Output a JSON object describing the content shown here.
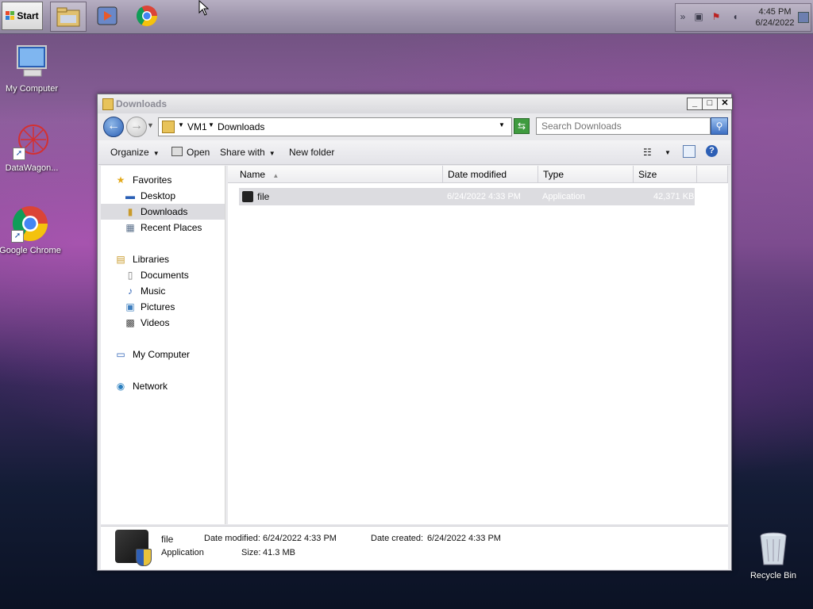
{
  "taskbar": {
    "start_label": "Start",
    "clock_time": "4:45 PM",
    "clock_date": "6/24/2022"
  },
  "desktop": {
    "icons": [
      {
        "label": "My Computer"
      },
      {
        "label": "DataWagon..."
      },
      {
        "label": "Google Chrome"
      },
      {
        "label": "Recycle Bin"
      }
    ]
  },
  "window": {
    "title": "Downloads",
    "address": {
      "segments": [
        "VM1",
        "Downloads"
      ],
      "search_placeholder": "Search Downloads"
    },
    "toolbar": {
      "organize": "Organize",
      "open": "Open",
      "share_with": "Share with",
      "new_folder": "New folder"
    },
    "nav": {
      "favorites": "Favorites",
      "desktop": "Desktop",
      "downloads": "Downloads",
      "recent_places": "Recent Places",
      "libraries": "Libraries",
      "documents": "Documents",
      "music": "Music",
      "pictures": "Pictures",
      "videos": "Videos",
      "my_computer": "My Computer",
      "network": "Network"
    },
    "columns": {
      "name": "Name",
      "date_modified": "Date modified",
      "type": "Type",
      "size": "Size"
    },
    "files": [
      {
        "name": "file",
        "date_modified": "6/24/2022 4:33 PM",
        "type": "Application",
        "size": "42,371 KB"
      }
    ],
    "details": {
      "name": "file",
      "type": "Application",
      "date_modified_label": "Date modified:",
      "date_modified": "6/24/2022 4:33 PM",
      "date_created_label": "Date created:",
      "date_created": "6/24/2022 4:33 PM",
      "size_label": "Size:",
      "size": "41.3 MB"
    }
  }
}
